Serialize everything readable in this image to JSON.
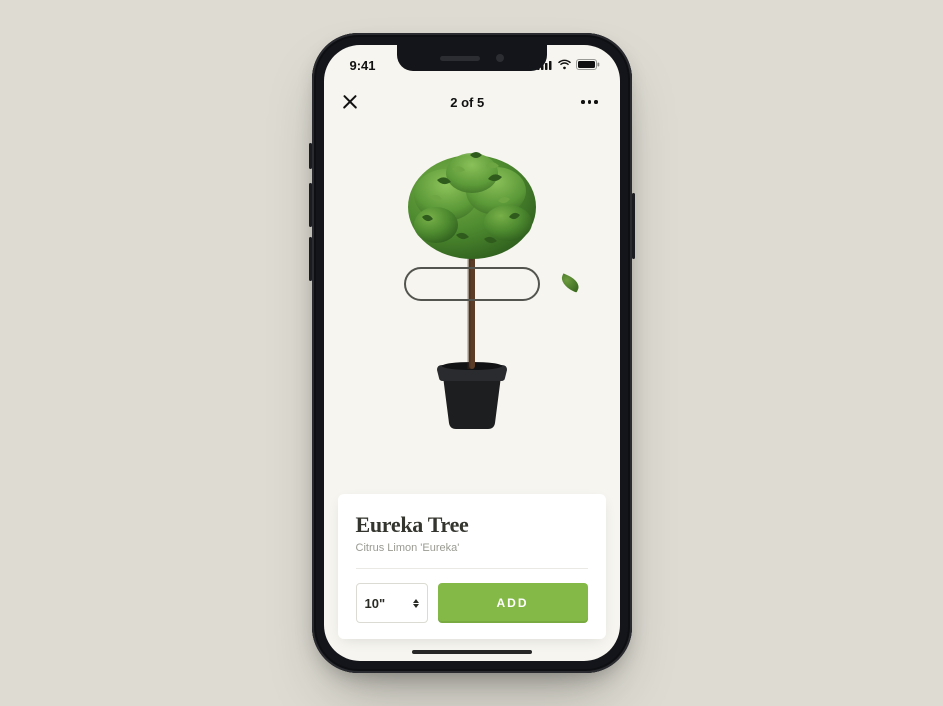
{
  "status": {
    "time": "9:41"
  },
  "nav": {
    "current": 2,
    "total": 5,
    "counter_text": "2 of 5"
  },
  "product": {
    "title": "Eureka Tree",
    "subtitle": "Citrus Limon 'Eureka'",
    "size_value": "10\"",
    "add_label": "ADD"
  },
  "colors": {
    "accent": "#84b947",
    "background": "#f6f5ef"
  }
}
